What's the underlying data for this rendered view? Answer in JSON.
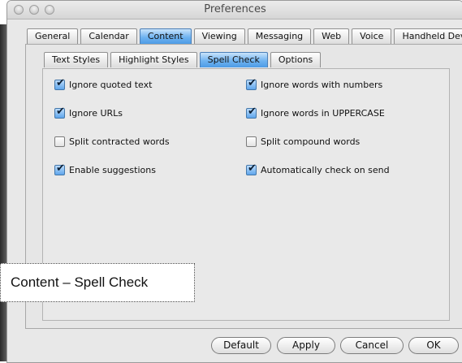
{
  "window": {
    "title": "Preferences"
  },
  "main_tabs": [
    {
      "label": "General",
      "selected": false
    },
    {
      "label": "Calendar",
      "selected": false
    },
    {
      "label": "Content",
      "selected": true
    },
    {
      "label": "Viewing",
      "selected": false
    },
    {
      "label": "Messaging",
      "selected": false
    },
    {
      "label": "Web",
      "selected": false
    },
    {
      "label": "Voice",
      "selected": false
    },
    {
      "label": "Handheld Devices",
      "selected": false
    }
  ],
  "sub_tabs": [
    {
      "label": "Text Styles",
      "selected": false
    },
    {
      "label": "Highlight Styles",
      "selected": false
    },
    {
      "label": "Spell Check",
      "selected": true
    },
    {
      "label": "Options",
      "selected": false
    }
  ],
  "options": [
    {
      "label": "Ignore quoted text",
      "checked": true
    },
    {
      "label": "Ignore words with numbers",
      "checked": true
    },
    {
      "label": "Ignore URLs",
      "checked": true
    },
    {
      "label": "Ignore words in UPPERCASE",
      "checked": true
    },
    {
      "label": "Split contracted words",
      "checked": false
    },
    {
      "label": "Split compound words",
      "checked": false
    },
    {
      "label": "Enable suggestions",
      "checked": true
    },
    {
      "label": "Automatically check on send",
      "checked": true
    }
  ],
  "buttons": {
    "default": "Default",
    "apply": "Apply",
    "cancel": "Cancel",
    "ok": "OK"
  },
  "caption": "Content – Spell Check",
  "colors": {
    "selected_tab": "#6fb3f0",
    "panel_bg": "#e8e8e8"
  }
}
